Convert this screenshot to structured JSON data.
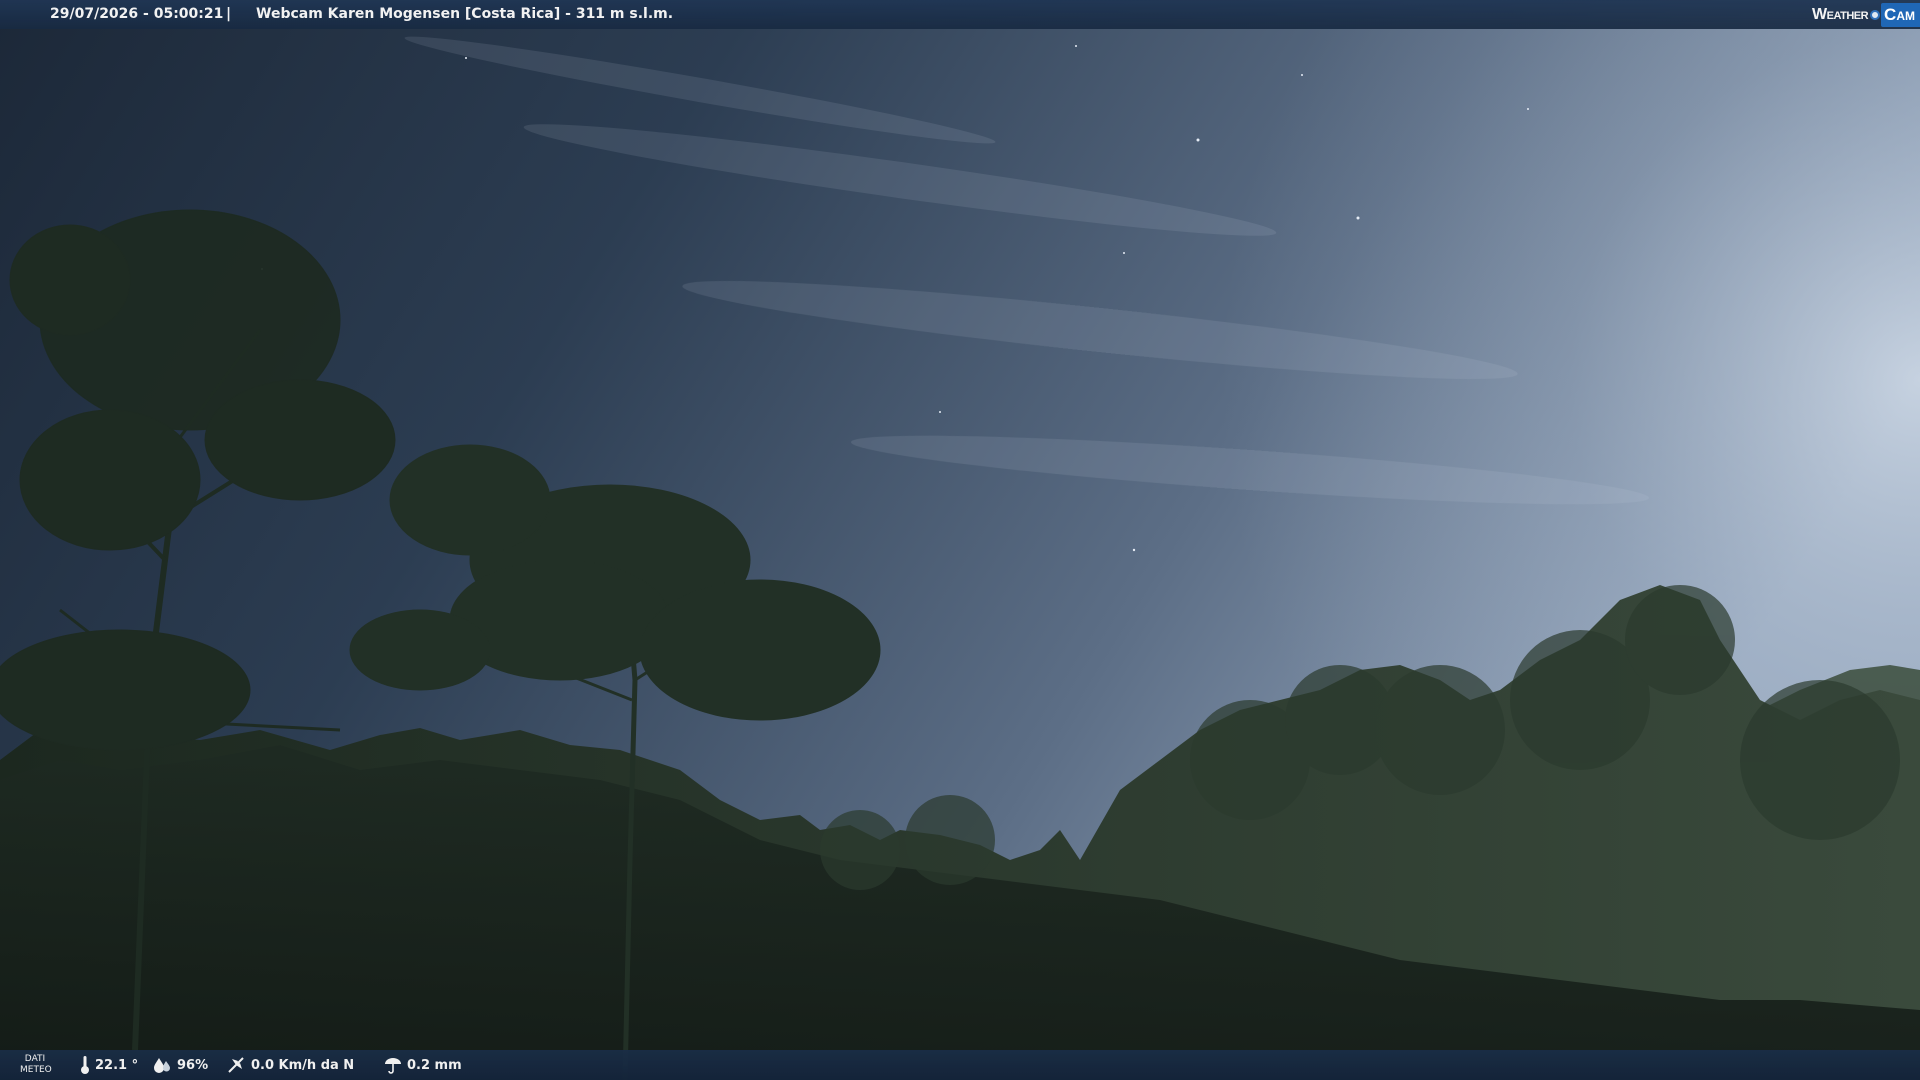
{
  "header": {
    "datetime": "29/07/2026 - 05:00:21",
    "separator": "|",
    "caption": "Webcam Karen Mogensen [Costa Rica] - 311 m s.l.m."
  },
  "logo": {
    "weather_text": "Weather",
    "cam_text": "Cam",
    "colors": {
      "accent": "#1f67b6"
    }
  },
  "weather_bar": {
    "label_line1": "DATI",
    "label_line2": "METEO",
    "temperature": "22.1 °",
    "humidity": "96%",
    "wind": "0.0 Km/h da N",
    "rain": "0.2 mm",
    "icons": [
      "thermometer-icon",
      "humidity-icon",
      "wind-icon",
      "rain-icon"
    ]
  }
}
